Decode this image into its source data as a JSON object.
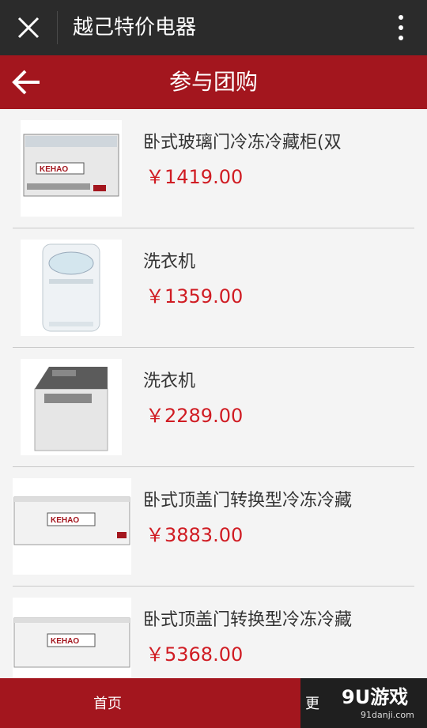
{
  "topbar": {
    "title": "越己特价电器",
    "close_icon": "close-icon",
    "more_icon": "more-vertical-icon"
  },
  "header": {
    "title": "参与团购",
    "back_icon": "back-arrow-icon"
  },
  "products": [
    {
      "name": "卧式玻璃门冷冻冷藏柜(双",
      "price": "￥1419.00",
      "image": "chest-freezer-glass"
    },
    {
      "name": "洗衣机",
      "price": "￥1359.00",
      "image": "washing-machine"
    },
    {
      "name": "洗衣机",
      "price": "￥2289.00",
      "image": "washing-machine-top"
    },
    {
      "name": "卧式顶盖门转换型冷冻冷藏",
      "price": "￥3883.00",
      "image": "chest-freezer-large"
    },
    {
      "name": "卧式顶盖门转换型冷冻冷藏",
      "price": "￥5368.00",
      "image": "chest-freezer-large"
    }
  ],
  "bottomnav": {
    "home": "首页",
    "more": "更"
  },
  "watermark": {
    "logo": "9U游戏",
    "url": "91danji.com"
  },
  "colors": {
    "header": "#a3161e",
    "topbar": "#2b2b2b",
    "price": "#d01c23"
  }
}
